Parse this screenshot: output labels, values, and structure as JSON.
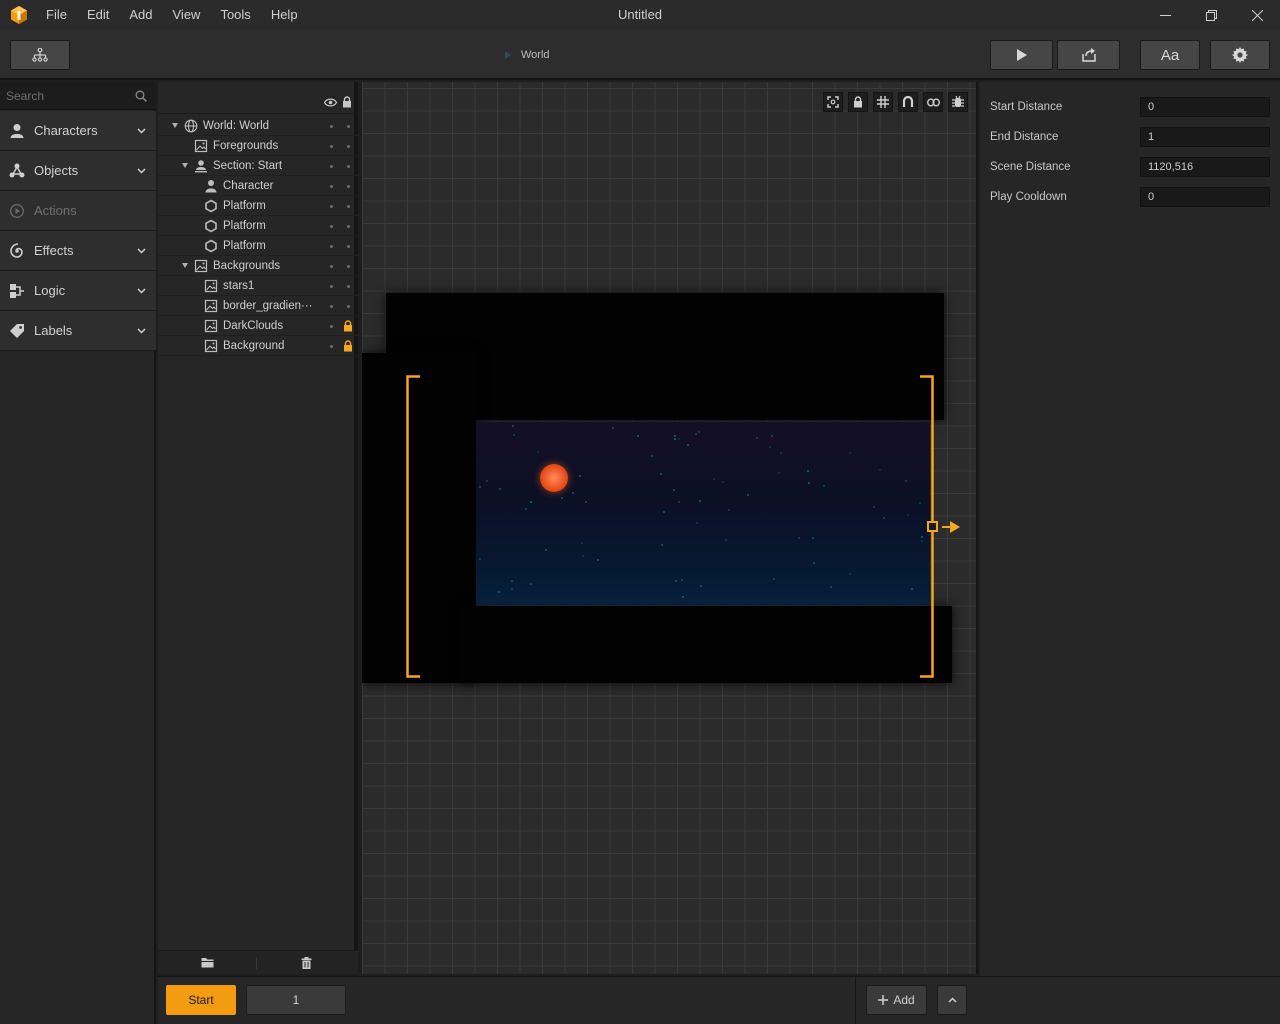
{
  "window": {
    "title": "Untitled"
  },
  "menu": [
    "File",
    "Edit",
    "Add",
    "View",
    "Tools",
    "Help"
  ],
  "breadcrumb": {
    "label": "World"
  },
  "toolbar": {
    "font_label": "Aa"
  },
  "search": {
    "placeholder": "Search"
  },
  "categories": [
    {
      "label": "Characters",
      "icon": "person-icon",
      "enabled": true
    },
    {
      "label": "Objects",
      "icon": "objects-icon",
      "enabled": true
    },
    {
      "label": "Actions",
      "icon": "play-circle-icon",
      "enabled": false
    },
    {
      "label": "Effects",
      "icon": "spiral-icon",
      "enabled": true
    },
    {
      "label": "Logic",
      "icon": "logic-icon",
      "enabled": true
    },
    {
      "label": "Labels",
      "icon": "tag-icon",
      "enabled": true
    }
  ],
  "hierarchy": [
    {
      "label": "World: World",
      "icon": "globe-icon",
      "expanded": true,
      "depth": 0,
      "locked": false
    },
    {
      "label": "Foregrounds",
      "icon": "image-icon",
      "expanded": false,
      "depth": 1,
      "locked": false
    },
    {
      "label": "Section: Start",
      "icon": "section-icon",
      "expanded": true,
      "depth": 1,
      "locked": false
    },
    {
      "label": "Character",
      "icon": "person-icon",
      "expanded": false,
      "depth": 2,
      "locked": false
    },
    {
      "label": "Platform",
      "icon": "hexagon-icon",
      "expanded": false,
      "depth": 2,
      "locked": false
    },
    {
      "label": "Platform",
      "icon": "hexagon-icon",
      "expanded": false,
      "depth": 2,
      "locked": false
    },
    {
      "label": "Platform",
      "icon": "hexagon-icon",
      "expanded": false,
      "depth": 2,
      "locked": false
    },
    {
      "label": "Backgrounds",
      "icon": "image-icon",
      "expanded": true,
      "depth": 1,
      "locked": false
    },
    {
      "label": "stars1",
      "icon": "image-icon",
      "expanded": false,
      "depth": 2,
      "locked": false
    },
    {
      "label": "border_gradien···",
      "icon": "image-icon",
      "expanded": false,
      "depth": 2,
      "locked": false
    },
    {
      "label": "DarkClouds",
      "icon": "image-icon",
      "expanded": false,
      "depth": 2,
      "locked": true
    },
    {
      "label": "Background",
      "icon": "image-icon",
      "expanded": false,
      "depth": 2,
      "locked": true
    }
  ],
  "canvas_tools": [
    "fit-icon",
    "lock-icon",
    "grid-icon",
    "magnet-icon",
    "link-icon",
    "debug-icon"
  ],
  "properties": [
    {
      "label": "Start Distance",
      "value": "0"
    },
    {
      "label": "End Distance",
      "value": "1"
    },
    {
      "label": "Scene Distance",
      "value": "1120,516"
    },
    {
      "label": "Play Cooldown",
      "value": "0"
    }
  ],
  "bottom": {
    "start_label": "Start",
    "scene_value": "1",
    "add_label": "Add"
  },
  "colors": {
    "accent": "#f39c12",
    "frame": "#f5a623",
    "sun": "#f0622e"
  }
}
